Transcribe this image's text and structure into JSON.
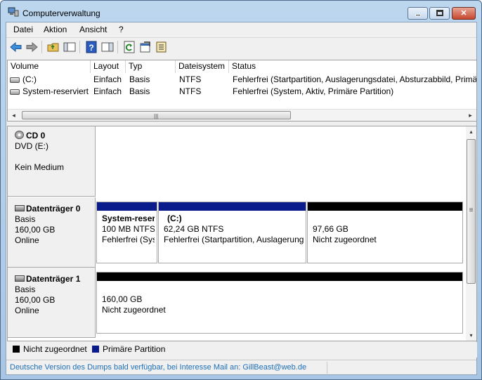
{
  "window": {
    "title": "Computerverwaltung",
    "minimize": "–",
    "maximize": "□",
    "close": "✕"
  },
  "menu": [
    "Datei",
    "Aktion",
    "Ansicht",
    "?"
  ],
  "toolbar": {
    "icons": [
      "back-arrow-icon",
      "forward-arrow-icon",
      "folder-up-icon",
      "console-tree-icon",
      "help-icon",
      "action-pane-icon",
      "refresh-icon",
      "properties-icon",
      "export-list-icon"
    ]
  },
  "volume_list": {
    "columns": [
      "Volume",
      "Layout",
      "Typ",
      "Dateisystem",
      "Status"
    ],
    "rows": [
      {
        "volume": "(C:)",
        "layout": "Einfach",
        "typ": "Basis",
        "fs": "NTFS",
        "status": "Fehlerfrei (Startpartition, Auslagerungsdatei, Absturzabbild, Primä"
      },
      {
        "volume": "System-reserviert",
        "layout": "Einfach",
        "typ": "Basis",
        "fs": "NTFS",
        "status": "Fehlerfrei (System, Aktiv, Primäre Partition)"
      }
    ],
    "scroll_left": "◂",
    "scroll_right": "▸",
    "scroll_grip": "|||"
  },
  "disks": [
    {
      "name": "CD 0",
      "lines": [
        "DVD (E:)",
        "",
        "Kein Medium"
      ]
    },
    {
      "name": "Datenträger 0",
      "lines": [
        "Basis",
        "160,00 GB",
        "Online"
      ],
      "partitions": [
        {
          "name": "System-reserv",
          "size": "100 MB NTFS",
          "status": "Fehlerfrei (Sys"
        },
        {
          "name": "(C:)",
          "size": "62,24 GB NTFS",
          "status": "Fehlerfrei (Startpartition, Auslagerung"
        },
        {
          "name": "",
          "size": "97,66 GB",
          "status": "Nicht zugeordnet"
        }
      ]
    },
    {
      "name": "Datenträger 1",
      "lines": [
        "Basis",
        "160,00 GB",
        "Online"
      ],
      "partitions": [
        {
          "name": "",
          "size": "160,00 GB",
          "status": "Nicht zugeordnet"
        }
      ]
    }
  ],
  "graph_scroll": {
    "up": "▴",
    "down": "▾",
    "grip": "≡"
  },
  "legend": [
    {
      "label": "Nicht zugeordnet",
      "color": "#000000"
    },
    {
      "label": "Primäre Partition",
      "color": "#0a1c8c"
    }
  ],
  "statusbar": {
    "text": "Deutsche Version des Dumps bald verfügbar, bei Interesse Mail an: GillBeast@web.de"
  }
}
